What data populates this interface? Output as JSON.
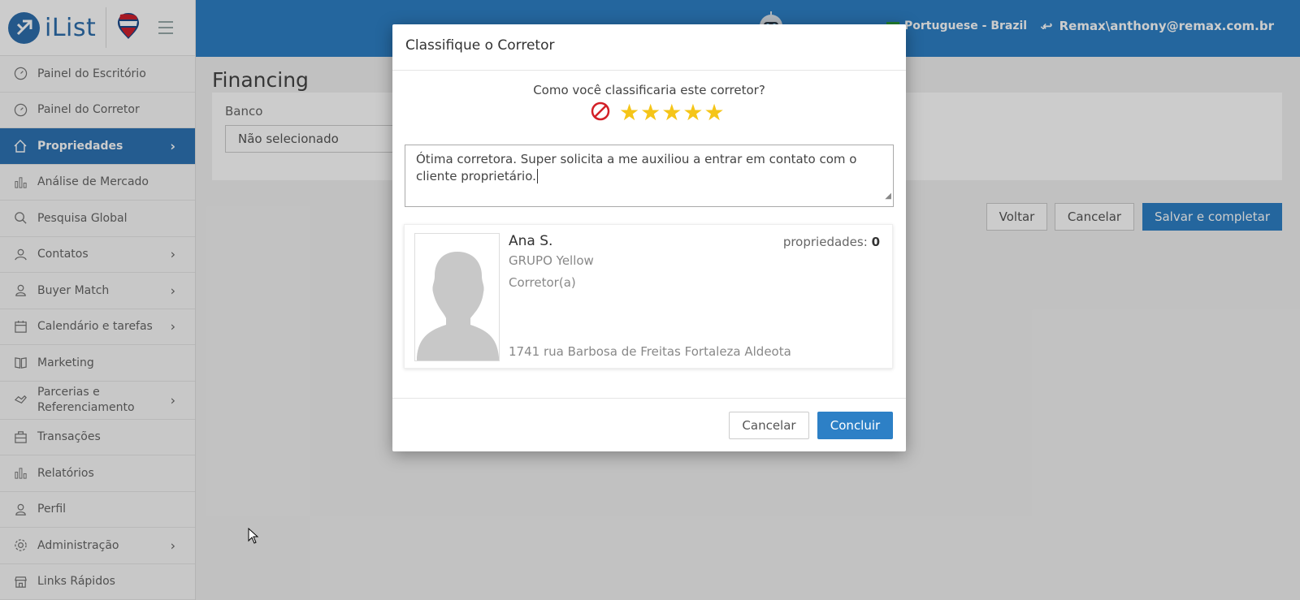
{
  "brand": {
    "app_name": "iList",
    "accent": "#2d80c6",
    "sidebar_active": "#2d74b4"
  },
  "sidebar": {
    "items": [
      {
        "label": "Painel do Escritório",
        "icon": "gauge-icon",
        "has_children": false,
        "active": false
      },
      {
        "label": "Painel do Corretor",
        "icon": "gauge-icon",
        "has_children": false,
        "active": false
      },
      {
        "label": "Propriedades",
        "icon": "home-icon",
        "has_children": true,
        "active": true
      },
      {
        "label": "Análise de Mercado",
        "icon": "bar-chart-icon",
        "has_children": false,
        "active": false
      },
      {
        "label": "Pesquisa Global",
        "icon": "search-icon",
        "has_children": false,
        "active": false
      },
      {
        "label": "Contatos",
        "icon": "contacts-icon",
        "has_children": true,
        "active": false
      },
      {
        "label": "Buyer Match",
        "icon": "user-icon",
        "has_children": true,
        "active": false
      },
      {
        "label": "Calendário e tarefas",
        "icon": "calendar-icon",
        "has_children": true,
        "active": false
      },
      {
        "label": "Marketing",
        "icon": "book-icon",
        "has_children": false,
        "active": false
      },
      {
        "label": "Parcerias e Referenciamento",
        "icon": "handshake-icon",
        "has_children": true,
        "active": false
      },
      {
        "label": "Transações",
        "icon": "briefcase-icon",
        "has_children": false,
        "active": false
      },
      {
        "label": "Relatórios",
        "icon": "bar-chart-icon",
        "has_children": false,
        "active": false
      },
      {
        "label": "Perfil",
        "icon": "user-icon",
        "has_children": false,
        "active": false
      },
      {
        "label": "Administração",
        "icon": "gear-icon",
        "has_children": true,
        "active": false
      },
      {
        "label": "Links Rápidos",
        "icon": "store-icon",
        "has_children": false,
        "active": false
      }
    ]
  },
  "header": {
    "language": "Portuguese - Brazil",
    "user": "Remax\\anthony@remax.com.br"
  },
  "page": {
    "title": "Financing",
    "bank_label": "Banco",
    "bank_value": "Não selecionado",
    "back_label": "Voltar",
    "cancel_label": "Cancelar",
    "save_label": "Salvar e completar"
  },
  "modal": {
    "title": "Classifique o Corretor",
    "question": "Como você classificaria este corretor?",
    "rating": 5,
    "comment": "Ótima corretora. Super solicita a me auxiliou a entrar em contato com o cliente proprietário.",
    "agent": {
      "name": "Ana S.",
      "group": "GRUPO Yellow",
      "role": "Corretor(a)",
      "address": "1741 rua Barbosa de Freitas Fortaleza Aldeota",
      "properties_label": "propriedades:",
      "properties_count": "0"
    },
    "cancel_label": "Cancelar",
    "confirm_label": "Concluir"
  }
}
